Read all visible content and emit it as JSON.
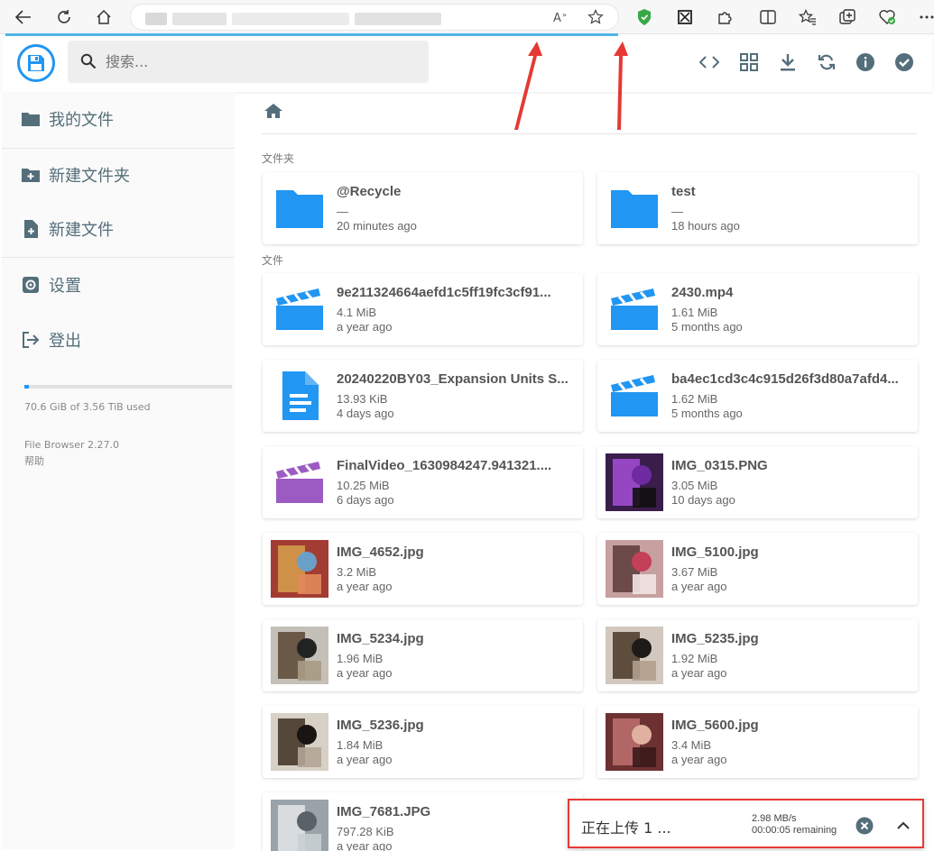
{
  "browser": {
    "icons": [
      "back-arrow-icon",
      "reload-icon",
      "home-icon",
      "read-aloud-icon",
      "favorite-star-icon",
      "shield-extension-icon",
      "screenshot-extension-icon",
      "extensions-puzzle-icon",
      "split-screen-icon",
      "favorites-icon",
      "collections-icon",
      "browser-essentials-icon",
      "more-icon"
    ],
    "load_progress": 0.66
  },
  "header": {
    "search_placeholder": "搜索...",
    "actions": [
      "code-icon",
      "grid-view-icon",
      "download-icon",
      "refresh-icon",
      "info-icon",
      "select-check-icon"
    ]
  },
  "sidebar": {
    "my_files": "我的文件",
    "new_folder": "新建文件夹",
    "new_file": "新建文件",
    "settings": "设置",
    "logout": "登出",
    "usage_text": "70.6 GiB of 3.56 TiB used",
    "usage_fraction": 0.02,
    "version": "File Browser 2.27.0",
    "help": "帮助"
  },
  "main": {
    "folders_label": "文件夹",
    "files_label": "文件",
    "folders": [
      {
        "name": "@Recycle",
        "size": "—",
        "date": "20 minutes ago"
      },
      {
        "name": "test",
        "size": "—",
        "date": "18 hours ago"
      }
    ],
    "files": [
      {
        "name": "9e211324664aefd1c5ff19fc3cf91...",
        "size": "4.1 MiB",
        "date": "a year ago",
        "kind": "video"
      },
      {
        "name": "2430.mp4",
        "size": "1.61 MiB",
        "date": "5 months ago",
        "kind": "video"
      },
      {
        "name": "20240220BY03_Expansion Units S...",
        "size": "13.93 KiB",
        "date": "4 days ago",
        "kind": "doc"
      },
      {
        "name": "ba4ec1cd3c4c915d26f3d80a7afd4...",
        "size": "1.62 MiB",
        "date": "5 months ago",
        "kind": "video"
      },
      {
        "name": "FinalVideo_1630984247.941321....",
        "size": "10.25 MiB",
        "date": "6 days ago",
        "kind": "video-purple"
      },
      {
        "name": "IMG_0315.PNG",
        "size": "3.05 MiB",
        "date": "10 days ago",
        "kind": "image"
      },
      {
        "name": "IMG_4652.jpg",
        "size": "3.2 MiB",
        "date": "a year ago",
        "kind": "image"
      },
      {
        "name": "IMG_5100.jpg",
        "size": "3.67 MiB",
        "date": "a year ago",
        "kind": "image"
      },
      {
        "name": "IMG_5234.jpg",
        "size": "1.96 MiB",
        "date": "a year ago",
        "kind": "image"
      },
      {
        "name": "IMG_5235.jpg",
        "size": "1.92 MiB",
        "date": "a year ago",
        "kind": "image"
      },
      {
        "name": "IMG_5236.jpg",
        "size": "1.84 MiB",
        "date": "a year ago",
        "kind": "image"
      },
      {
        "name": "IMG_5600.jpg",
        "size": "3.4 MiB",
        "date": "a year ago",
        "kind": "image"
      },
      {
        "name": "IMG_7681.JPG",
        "size": "797.28 KiB",
        "date": "a year ago",
        "kind": "image"
      }
    ]
  },
  "upload": {
    "title": "正在上传 1 ...",
    "speed": "2.98 MB/s",
    "remaining": "00:00:05 remaining"
  },
  "colors": {
    "accent": "#2196f3",
    "folder_icon": "#2196f3",
    "purple_video": "#9c5bc3",
    "sidebar_text": "#546e7a",
    "annotation_red": "#e53935"
  }
}
